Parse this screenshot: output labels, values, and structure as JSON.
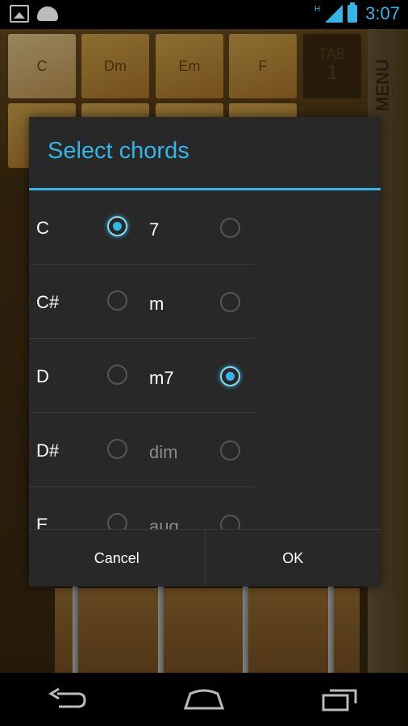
{
  "statusbar": {
    "network_label": "H",
    "time": "3:07"
  },
  "app": {
    "chords": [
      "C",
      "Dm",
      "Em",
      "F"
    ],
    "tab_label": "TAB",
    "tab_number": "1",
    "menu_label": "MENU"
  },
  "dialog": {
    "title": "Select chords",
    "roots": [
      {
        "label": "C",
        "checked": true
      },
      {
        "label": "C#",
        "checked": false
      },
      {
        "label": "D",
        "checked": false
      },
      {
        "label": "D#",
        "checked": false
      },
      {
        "label": "E",
        "checked": false
      }
    ],
    "qualities": [
      {
        "label": "7",
        "checked": false
      },
      {
        "label": "m",
        "checked": false
      },
      {
        "label": "m7",
        "checked": true
      },
      {
        "label": "dim",
        "checked": false
      },
      {
        "label": "aug",
        "checked": false
      }
    ],
    "cancel_label": "Cancel",
    "ok_label": "OK"
  },
  "colors": {
    "accent": "#33b5e5",
    "dialog_bg": "#282828"
  }
}
